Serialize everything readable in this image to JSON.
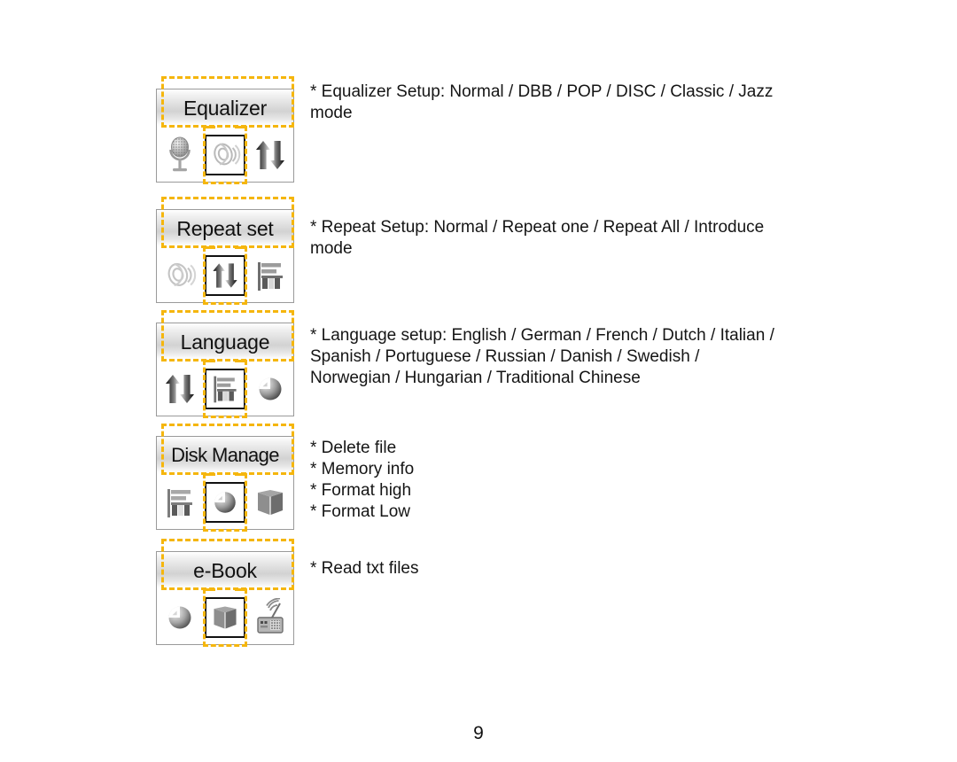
{
  "page": {
    "number": "9"
  },
  "menus": [
    {
      "id": "equalizer",
      "title": "Equalizer",
      "icons": {
        "left": "microphone-icon",
        "center": "speaker-icon",
        "right": "updown-arrows-icon"
      },
      "description_lines": [
        "* Equalizer Setup: Normal / DBB / POP / DISC / Classic / Jazz",
        "mode"
      ],
      "description": "* Equalizer Setup: Normal / DBB / POP / DISC / Classic / Jazz mode",
      "options": [
        "Normal",
        "DBB",
        "POP",
        "DISC",
        "Classic",
        "Jazz"
      ]
    },
    {
      "id": "repeat-set",
      "title": "Repeat set",
      "icons": {
        "left": "speaker-icon",
        "center": "updown-arrows-icon",
        "right": "flag-chart-icon"
      },
      "description_lines": [
        "* Repeat Setup: Normal / Repeat one / Repeat All / Introduce",
        "mode"
      ],
      "description": "* Repeat Setup: Normal / Repeat one / Repeat All / Introduce mode",
      "options": [
        "Normal",
        "Repeat one",
        "Repeat All",
        "Introduce"
      ]
    },
    {
      "id": "language",
      "title": "Language",
      "icons": {
        "left": "updown-arrows-icon",
        "center": "flag-chart-icon",
        "right": "pie-disk-icon"
      },
      "description_lines": [
        "* Language setup: English / German / French / Dutch / Italian /",
        "Spanish / Portuguese / Russian / Danish / Swedish /",
        "Norwegian / Hungarian / Traditional Chinese"
      ],
      "description": "* Language setup: English / German / French / Dutch / Italian / Spanish / Portuguese / Russian / Danish / Swedish / Norwegian / Hungarian / Traditional Chinese",
      "options": [
        "English",
        "German",
        "French",
        "Dutch",
        "Italian",
        "Spanish",
        "Portuguese",
        "Russian",
        "Danish",
        "Swedish",
        "Norwegian",
        "Hungarian",
        "Traditional Chinese"
      ]
    },
    {
      "id": "disk-manage",
      "title": "Disk Manage",
      "icons": {
        "left": "flag-chart-icon",
        "center": "pie-disk-icon",
        "right": "book-icon"
      },
      "description_lines": [
        "* Delete file",
        "* Memory info",
        "* Format high",
        "* Format Low"
      ],
      "options": [
        "Delete file",
        "Memory info",
        "Format high",
        "Format Low"
      ]
    },
    {
      "id": "e-book",
      "title": "e-Book",
      "icons": {
        "left": "pie-disk-icon",
        "center": "book-icon",
        "right": "radio-icon"
      },
      "description_lines": [
        "* Read txt files"
      ],
      "options": [
        "Read txt files"
      ]
    }
  ],
  "colors": {
    "highlight_dashed": "#f5b60d",
    "panel_border": "#9a9a9a",
    "text": "#151515"
  }
}
